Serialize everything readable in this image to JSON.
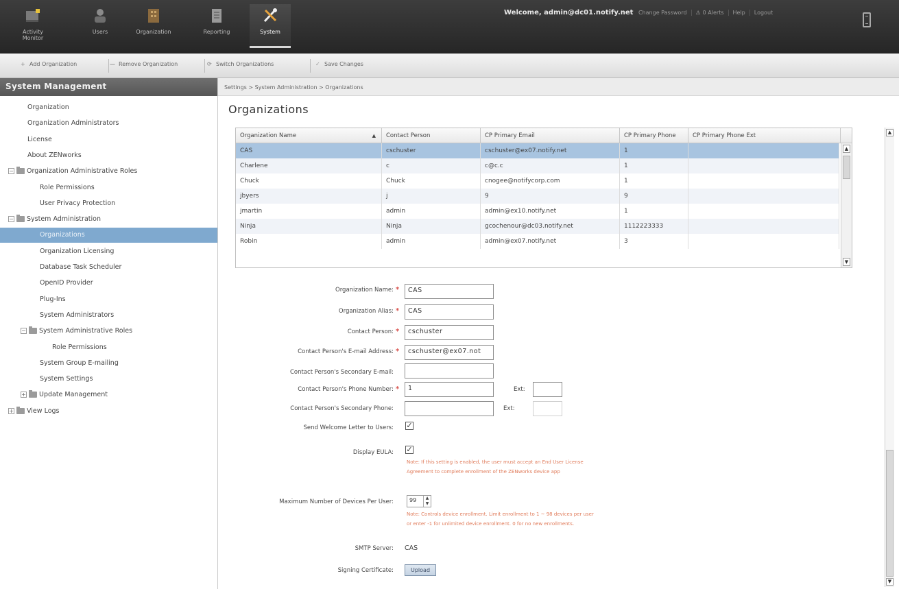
{
  "nav": {
    "items": [
      {
        "label": "Activity Monitor",
        "icon": "activity-monitor-icon"
      },
      {
        "label": "Users",
        "icon": "users-icon"
      },
      {
        "label": "Organization",
        "icon": "organization-icon"
      },
      {
        "label": "Reporting",
        "icon": "reporting-icon"
      },
      {
        "label": "System",
        "icon": "system-tools-icon"
      }
    ],
    "active": "System",
    "welcome": "Welcome, admin@dc01.notify.net",
    "links": [
      "Change Password",
      "0 Alerts",
      "Help",
      "Logout"
    ]
  },
  "toolbar": {
    "add_org": "Add Organization",
    "remove_org": "Remove Organization",
    "switch_orgs": "Switch Organizations",
    "save_changes": "Save Changes"
  },
  "sidebar": {
    "title": "System Management",
    "items": [
      {
        "label": "Organization",
        "level": 0
      },
      {
        "label": "Organization Administrators",
        "level": 0
      },
      {
        "label": "License",
        "level": 0
      },
      {
        "label": "About ZENworks",
        "level": 0
      },
      {
        "label": "Organization Administrative Roles",
        "level": 0,
        "folder": true,
        "expanded": true
      },
      {
        "label": "Role Permissions",
        "level": 1
      },
      {
        "label": "User Privacy Protection",
        "level": 1
      },
      {
        "label": "System Administration",
        "level": 0,
        "folder": true,
        "expanded": true
      },
      {
        "label": "Organizations",
        "level": 1,
        "selected": true
      },
      {
        "label": "Organization Licensing",
        "level": 1
      },
      {
        "label": "Database Task Scheduler",
        "level": 1
      },
      {
        "label": "OpenID Provider",
        "level": 1
      },
      {
        "label": "Plug-Ins",
        "level": 1
      },
      {
        "label": "System Administrators",
        "level": 1
      },
      {
        "label": "System Administrative Roles",
        "level": 1,
        "folder": true,
        "expanded": true
      },
      {
        "label": "Role Permissions",
        "level": 2
      },
      {
        "label": "System Group E-mailing",
        "level": 1
      },
      {
        "label": "System Settings",
        "level": 1
      },
      {
        "label": "Update Management",
        "level": 1,
        "folder": true,
        "expanded": false
      },
      {
        "label": "View Logs",
        "level": 0,
        "folder": true,
        "expanded": false
      }
    ]
  },
  "breadcrumb": "Settings > System Administration > Organizations",
  "page_title": "Organizations",
  "grid": {
    "columns": [
      "Organization Name",
      "Contact Person",
      "CP Primary Email",
      "CP Primary Phone",
      "CP Primary Phone Ext"
    ],
    "sort_indicator": "▲",
    "rows": [
      [
        "CAS",
        "cschuster",
        "cschuster@ex07.notify.net",
        "1",
        ""
      ],
      [
        "Charlene",
        "c",
        "c@c.c",
        "1",
        ""
      ],
      [
        "Chuck",
        "Chuck",
        "cnogee@notifycorp.com",
        "1",
        ""
      ],
      [
        "jbyers",
        "j",
        "9",
        "9",
        ""
      ],
      [
        "jmartin",
        "admin",
        "admin@ex10.notify.net",
        "1",
        ""
      ],
      [
        "Ninja",
        "Ninja",
        "gcochenour@dc03.notify.net",
        "1112223333",
        ""
      ],
      [
        "Robin",
        "admin",
        "admin@ex07.notify.net",
        "3",
        ""
      ]
    ]
  },
  "form": {
    "org_name_label": "Organization Name:",
    "org_name_value": "CAS",
    "org_alias_label": "Organization Alias:",
    "org_alias_value": "CAS",
    "contact_label": "Contact Person:",
    "contact_value": "cschuster",
    "email_label": "Contact Person's E-mail Address:",
    "email_value": "cschuster@ex07.not",
    "sec_email_label": "Contact Person's Secondary E-mail:",
    "sec_email_value": "",
    "phone_label": "Contact Person's Phone Number:",
    "phone_value": "1",
    "ext_label": "Ext:",
    "phone_ext_value": "",
    "sec_phone_label": "Contact Person's Secondary Phone:",
    "sec_phone_value": "",
    "sec_ext_label": "Ext:",
    "sec_phone_ext_value": "",
    "welcome_letter_label": "Send Welcome Letter to Users:",
    "welcome_letter_checked": true,
    "eula_label": "Display EULA:",
    "eula_checked": true,
    "eula_note_1": "Note: If this setting is enabled, the user must accept an End User License",
    "eula_note_2": "Agreement to complete enrollment of the ZENworks device app",
    "max_devices_label": "Maximum Number of Devices Per User:",
    "max_devices_value": "99",
    "devices_note_1": "Note: Controls device enrollment. Limit enrollment to 1 ~ 98 devices per user",
    "devices_note_2": "or enter -1 for unlimited device enrollment. 0 for no new enrollments.",
    "smtp_label": "SMTP Server:",
    "smtp_value": "CAS",
    "cert_label": "Signing Certificate:",
    "upload_label": "Upload"
  },
  "colors": {
    "topbar": "#2f2f2f",
    "selected_row": "#a8c4e0",
    "sidebar_selected": "#7fa9cf",
    "note_text": "#e07b5a",
    "required": "#d9534f"
  }
}
